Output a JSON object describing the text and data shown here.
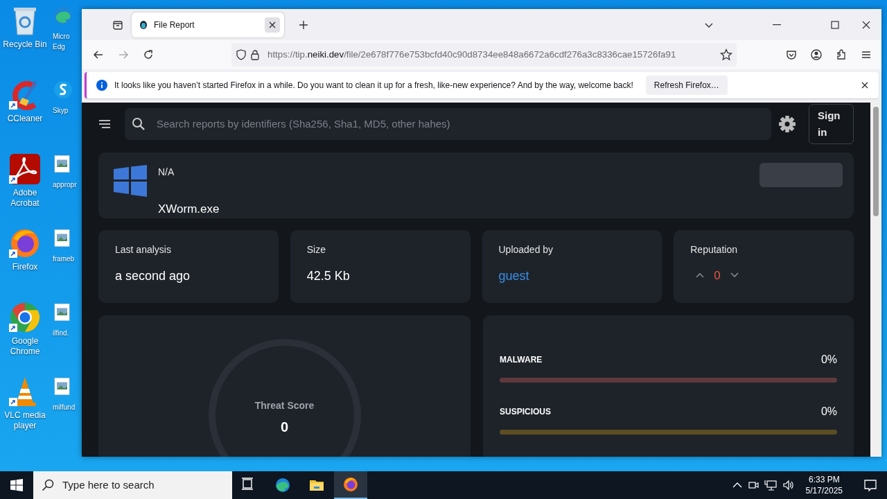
{
  "desktop": {
    "icon_columns": [
      {
        "icons": [
          {
            "kind": "recycle",
            "label": "Recycle Bin"
          },
          {
            "kind": "ccleaner",
            "label": "CCleaner"
          },
          {
            "kind": "acrobat",
            "label": "Adobe Acrobat"
          },
          {
            "kind": "firefox",
            "label": "Firefox"
          },
          {
            "kind": "chrome",
            "label": "Google Chrome"
          },
          {
            "kind": "vlc",
            "label": "VLC media player"
          }
        ]
      },
      {
        "icons": [
          {
            "kind": "edge",
            "label": "Micro Edg"
          },
          {
            "kind": "skype",
            "label": "Skyp"
          },
          {
            "kind": "image",
            "label": "appropr"
          },
          {
            "kind": "image",
            "label": "frameb"
          },
          {
            "kind": "image",
            "label": "ilfind."
          },
          {
            "kind": "image",
            "label": "milfund"
          }
        ]
      }
    ]
  },
  "browser": {
    "tabs": [
      {
        "title": "File Report",
        "selected": true
      }
    ],
    "url": {
      "prefix": "https://tip.",
      "domain": "neiki.dev",
      "path": "/file/2e678f776e753bcfd40c90d8734ee848a6672a6cdf276a3c8336cae15726fa91"
    },
    "notification": {
      "message": "It looks like you haven’t started Firefox in a while. Do you want to clean it up for a fresh, like-new experience? And by the way, welcome back!",
      "button": "Refresh Firefox…"
    }
  },
  "page": {
    "search": {
      "placeholder": "Search reports by identifiers (Sha256, Sha1, MD5, other hahes)"
    },
    "sign_in": "Sign in",
    "file": {
      "platform": "N/A",
      "name": "XWorm.exe"
    },
    "stats": [
      {
        "kind": "text",
        "label": "Last analysis",
        "value": "a second ago"
      },
      {
        "kind": "text",
        "label": "Size",
        "value": "42.5 Kb"
      },
      {
        "kind": "link",
        "label": "Uploaded by",
        "value": "guest"
      },
      {
        "kind": "vote",
        "label": "Reputation",
        "value": "0"
      }
    ],
    "threat_score": {
      "label": "Threat Score",
      "value": "0"
    },
    "verdicts": [
      {
        "label": "MALWARE",
        "value": "0%",
        "level": 0,
        "color": "#5e3a3c"
      },
      {
        "label": "SUSPICIOUS",
        "value": "0%",
        "level": 0,
        "color": "#5c4d22"
      }
    ]
  },
  "taskbar": {
    "search": {
      "placeholder": "Type here to search"
    },
    "apps": [
      {
        "kind": "taskview",
        "active": false
      },
      {
        "kind": "edge",
        "active": false
      },
      {
        "kind": "explorer",
        "active": false
      },
      {
        "kind": "firefox",
        "active": true
      }
    ],
    "time": "6:33 PM",
    "date": "5/17/2025"
  }
}
